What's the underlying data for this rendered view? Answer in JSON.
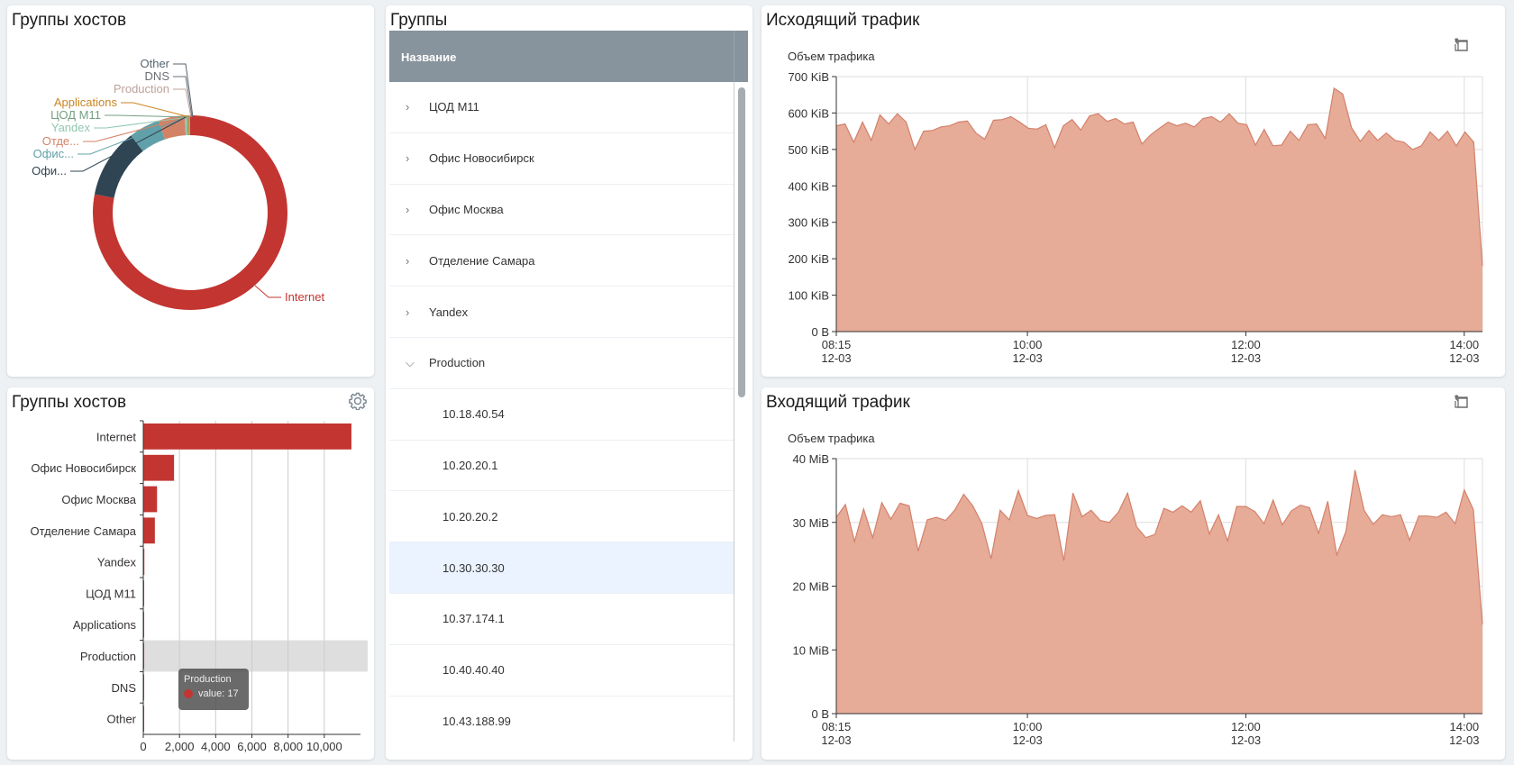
{
  "donut_panel": {
    "title": "Группы хостов",
    "chart_data": {
      "type": "pie",
      "variant": "donut",
      "slices": [
        {
          "label": "Internet",
          "display_label": "Internet",
          "value": 11500,
          "color": "#c23531"
        },
        {
          "label": "Офис Новосибирск",
          "display_label": "Офи...",
          "value": 1700,
          "color": "#2f4554"
        },
        {
          "label": "Офис Москва",
          "display_label": "Офис...",
          "value": 760,
          "color": "#61a0a8"
        },
        {
          "label": "Отделение Самара",
          "display_label": "Отде...",
          "value": 640,
          "color": "#d48265"
        },
        {
          "label": "Yandex",
          "display_label": "Yandex",
          "value": 60,
          "color": "#91c7ae"
        },
        {
          "label": "ЦОД М11",
          "display_label": "ЦОД М11",
          "value": 30,
          "color": "#749f83"
        },
        {
          "label": "Applications",
          "display_label": "Applications",
          "value": 20,
          "color": "#ca8622"
        },
        {
          "label": "Production",
          "display_label": "Production",
          "value": 17,
          "color": "#bda29a"
        },
        {
          "label": "DNS",
          "display_label": "DNS",
          "value": 5,
          "color": "#6e7074"
        },
        {
          "label": "Other",
          "display_label": "Other",
          "value": 3,
          "color": "#546570"
        }
      ]
    }
  },
  "bar_panel": {
    "title": "Группы хостов",
    "settings_icon": "gear-icon",
    "tooltip": {
      "title": "Production",
      "value_label": "value: 17"
    },
    "highlighted_category": "Production",
    "chart_data": {
      "type": "bar",
      "orientation": "horizontal",
      "categories": [
        "Internet",
        "Офис Новосибирск",
        "Офис Москва",
        "Отделение Самара",
        "Yandex",
        "ЦОД М11",
        "Applications",
        "Production",
        "DNS",
        "Other"
      ],
      "values": [
        11500,
        1700,
        760,
        640,
        60,
        30,
        20,
        17,
        5,
        3
      ],
      "xlim": [
        0,
        12000
      ],
      "xticks": [
        0,
        2000,
        4000,
        6000,
        8000,
        10000
      ],
      "xtick_labels": [
        "0",
        "2,000",
        "4,000",
        "6,000",
        "8,000",
        "10,000"
      ],
      "color": "#c23531",
      "grid": true
    }
  },
  "groups_panel": {
    "title": "Группы",
    "column_header": "Название",
    "rows": [
      {
        "label": "ЦОД М11",
        "type": "group",
        "expanded": false,
        "selected": false
      },
      {
        "label": "Офис Новосибирск",
        "type": "group",
        "expanded": false,
        "selected": false
      },
      {
        "label": "Офис Москва",
        "type": "group",
        "expanded": false,
        "selected": false
      },
      {
        "label": "Отделение Самара",
        "type": "group",
        "expanded": false,
        "selected": false
      },
      {
        "label": "Yandex",
        "type": "group",
        "expanded": false,
        "selected": false
      },
      {
        "label": "Production",
        "type": "group",
        "expanded": true,
        "selected": false
      },
      {
        "label": "10.18.40.54",
        "type": "host",
        "selected": false
      },
      {
        "label": "10.20.20.1",
        "type": "host",
        "selected": false
      },
      {
        "label": "10.20.20.2",
        "type": "host",
        "selected": false
      },
      {
        "label": "10.30.30.30",
        "type": "host",
        "selected": true
      },
      {
        "label": "10.37.174.1",
        "type": "host",
        "selected": false
      },
      {
        "label": "10.40.40.40",
        "type": "host",
        "selected": false
      },
      {
        "label": "10.43.188.99",
        "type": "host",
        "selected": false
      }
    ]
  },
  "outgoing_panel": {
    "title": "Исходящий трафик",
    "toolbox": [
      "zoom-area-icon",
      "zoom-reset-icon"
    ],
    "chart_data": {
      "type": "area",
      "title": "Объем трафика",
      "ylabel": "Объем трафика",
      "color": "#e5a892",
      "line_color": "#d4806a",
      "ylim": [
        0,
        700
      ],
      "yticks": [
        0,
        100,
        200,
        300,
        400,
        500,
        600,
        700
      ],
      "ytick_labels": [
        "0 B",
        "100 KiB",
        "200 KiB",
        "300 KiB",
        "400 KiB",
        "500 KiB",
        "600 KiB",
        "700 KiB"
      ],
      "x_range_minutes": [
        495,
        850
      ],
      "xticks_minutes": [
        495,
        600,
        720,
        840
      ],
      "xtick_labels": [
        [
          "08:15",
          "12-03"
        ],
        [
          "10:00",
          "12-03"
        ],
        [
          "12:00",
          "12-03"
        ],
        [
          "14:00",
          "12-03"
        ]
      ],
      "grid": true,
      "series": [
        {
          "name": "Объем трафика",
          "values": [
            565,
            570,
            520,
            575,
            525,
            595,
            570,
            598,
            575,
            500,
            550,
            552,
            562,
            565,
            575,
            578,
            545,
            528,
            580,
            582,
            590,
            575,
            558,
            556,
            568,
            505,
            565,
            582,
            553,
            592,
            598,
            577,
            585,
            570,
            575,
            515,
            540,
            558,
            575,
            565,
            572,
            562,
            585,
            590,
            575,
            598,
            572,
            568,
            512,
            555,
            510,
            512,
            550,
            525,
            568,
            570,
            530,
            668,
            652,
            560,
            522,
            552,
            525,
            545,
            525,
            520,
            500,
            510,
            548,
            525,
            550,
            510,
            548,
            520,
            180
          ]
        }
      ]
    }
  },
  "incoming_panel": {
    "title": "Входящий трафик",
    "toolbox": [
      "zoom-area-icon",
      "zoom-reset-icon"
    ],
    "chart_data": {
      "type": "area",
      "title": "Объем трафика",
      "ylabel": "Объем трафика",
      "color": "#e5a892",
      "line_color": "#d4806a",
      "ylim": [
        0,
        40
      ],
      "yticks": [
        0,
        10,
        20,
        30,
        40
      ],
      "ytick_labels": [
        "0 B",
        "10 MiB",
        "20 MiB",
        "30 MiB",
        "40 MiB"
      ],
      "x_range_minutes": [
        495,
        850
      ],
      "xticks_minutes": [
        495,
        600,
        720,
        840
      ],
      "xtick_labels": [
        [
          "08:15",
          "12-03"
        ],
        [
          "10:00",
          "12-03"
        ],
        [
          "12:00",
          "12-03"
        ],
        [
          "14:00",
          "12-03"
        ]
      ],
      "grid": true,
      "series": [
        {
          "name": "Объем трафика",
          "values": [
            30.8,
            32.8,
            27.0,
            32.1,
            27.6,
            33.1,
            30.5,
            33.0,
            32.6,
            25.5,
            30.4,
            30.8,
            30.3,
            31.9,
            34.4,
            32.6,
            29.8,
            24.3,
            31.9,
            30.4,
            35.0,
            31.1,
            30.6,
            31.1,
            31.2,
            24.0,
            34.6,
            30.9,
            31.9,
            30.3,
            30.0,
            31.6,
            34.6,
            29.3,
            27.6,
            28.1,
            32.2,
            31.6,
            32.6,
            31.6,
            33.4,
            28.2,
            31.2,
            27.1,
            32.5,
            32.5,
            31.7,
            29.8,
            33.5,
            29.6,
            31.8,
            32.7,
            32.3,
            28.3,
            33.3,
            24.9,
            28.6,
            38.2,
            31.9,
            29.7,
            31.2,
            30.9,
            31.2,
            27.2,
            31.0,
            31.0,
            30.8,
            31.6,
            29.8,
            35.1,
            32.0,
            14.0
          ]
        }
      ]
    }
  }
}
